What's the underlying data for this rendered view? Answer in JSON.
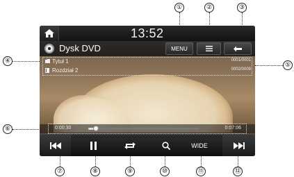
{
  "topbar": {
    "clock": "13:52",
    "home_icon": "home-icon"
  },
  "source": {
    "title": "Dysk DVD",
    "icon": "disc-icon"
  },
  "buttons": {
    "menu": "MENU",
    "list_icon": "list-icon",
    "back_icon": "back-arrow-icon"
  },
  "info": {
    "title_label": "Tytuł 1",
    "title_count": "0001/0001",
    "chapter_label": "Rozdział 2",
    "chapter_count": "0002/0009"
  },
  "progress": {
    "elapsed": "0:00:30",
    "total": "0:07:06",
    "fraction": 0.07
  },
  "controls": {
    "prev_icon": "skip-previous-icon",
    "pause_icon": "pause-icon",
    "repeat_icon": "repeat-icon",
    "zoom_icon": "search-icon",
    "wide": "WIDE",
    "next_icon": "skip-next-icon"
  },
  "callouts": [
    "①",
    "②",
    "③",
    "④",
    "⑤",
    "⑥",
    "⑦",
    "⑧",
    "⑨",
    "⑩",
    "⑪",
    "⑫"
  ],
  "colors": {
    "screen_bg": "#1b1b1b",
    "bar_top": "#2d2d2d",
    "bar_bottom": "#0f0f0f",
    "text": "#ffffff"
  }
}
